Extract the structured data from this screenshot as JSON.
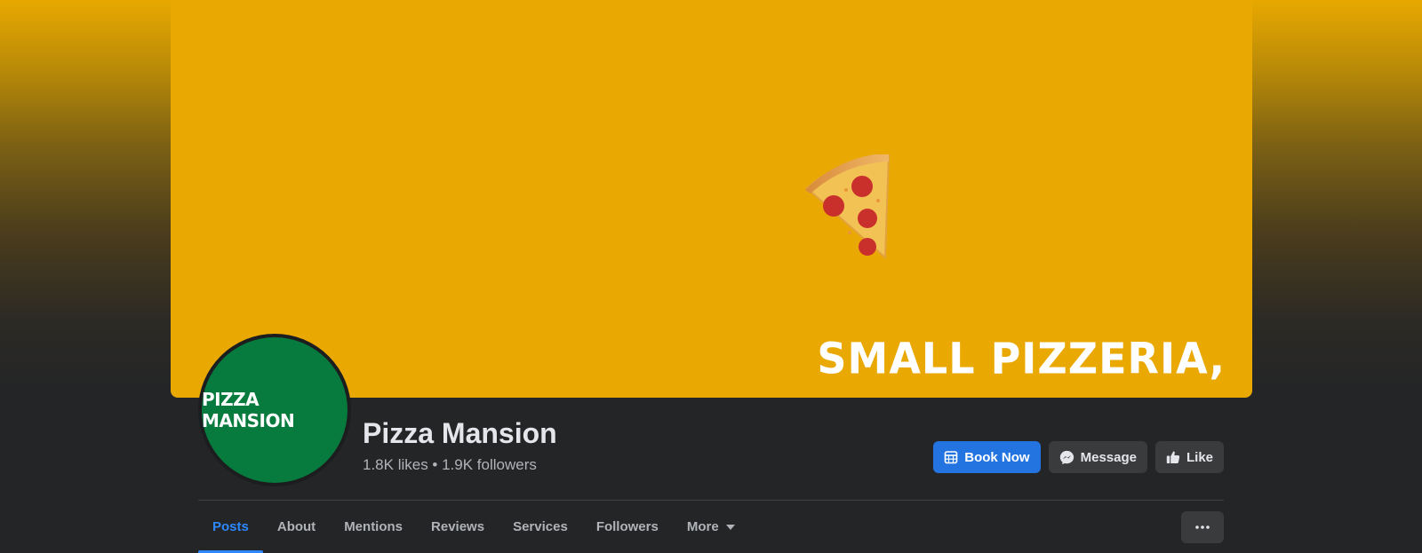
{
  "cover": {
    "slogan": "SMALL PIZZERIA,",
    "background_color": "#eaa902",
    "image_icon": "pizza-slice-icon"
  },
  "profile": {
    "avatar_text": "PIZZA MANSION",
    "avatar_color": "#077a3d",
    "name": "Pizza Mansion",
    "stats": "1.8K likes • 1.9K followers"
  },
  "actions": {
    "book_now": {
      "label": "Book Now",
      "icon": "calendar-icon"
    },
    "message": {
      "label": "Message",
      "icon": "messenger-icon"
    },
    "like": {
      "label": "Like",
      "icon": "thumbs-up-icon"
    }
  },
  "tabs": [
    {
      "label": "Posts",
      "active": true
    },
    {
      "label": "About",
      "active": false
    },
    {
      "label": "Mentions",
      "active": false
    },
    {
      "label": "Reviews",
      "active": false
    },
    {
      "label": "Services",
      "active": false
    },
    {
      "label": "Followers",
      "active": false
    },
    {
      "label": "More",
      "active": false
    }
  ],
  "more_options_icon": "ellipsis-icon",
  "colors": {
    "accent": "#2d88ff",
    "primary_button": "#2374e1",
    "surface": "#242526"
  }
}
